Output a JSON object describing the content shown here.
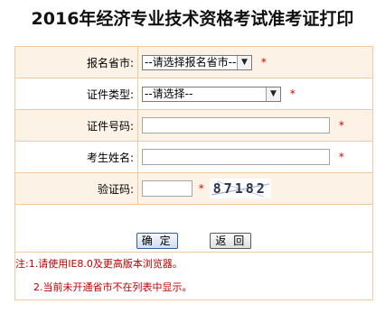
{
  "title": "2016年经济专业技术资格考试准考证打印",
  "form": {
    "province": {
      "label": "报名省市:",
      "selected": "--请选择报名省市--",
      "required": "*"
    },
    "id_type": {
      "label": "证件类型:",
      "selected": "--请选择--",
      "required": "*"
    },
    "id_number": {
      "label": "证件号码:",
      "value": "",
      "required": "*"
    },
    "name": {
      "label": "考生姓名:",
      "value": "",
      "required": "*"
    },
    "captcha": {
      "label": "验证码:",
      "value": "",
      "required": "*",
      "image_text": "87182"
    }
  },
  "buttons": {
    "confirm": "确 定",
    "back": "返 回"
  },
  "notes": {
    "prefix": "注:",
    "line1": "1.请使用IE8.0及更高版本浏览器。",
    "line2": "2.当前未开通省市不在列表中显示。"
  },
  "colors": {
    "border": "#f0c9a0",
    "shade": "#fdf2e6",
    "required": "#e00000",
    "note": "#c00000"
  }
}
